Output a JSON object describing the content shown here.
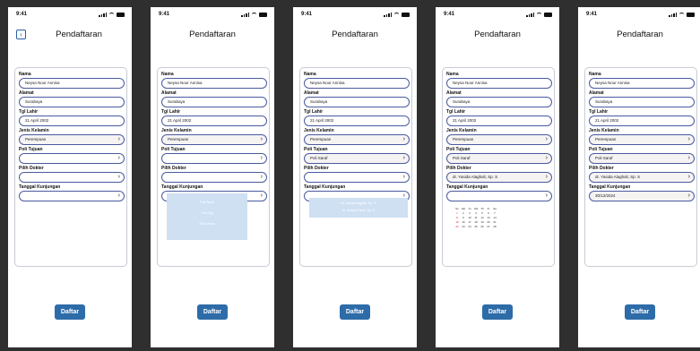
{
  "status_time": "9:41",
  "header_title": "Pendaftaran",
  "labels": {
    "nama": "Nama",
    "alamat": "Alamat",
    "tgl_lahir": "Tgl Lahir",
    "jenis_kelamin": "Jenis Kelamin",
    "poli_tujuan": "Poli Tujuan",
    "pilih_dokter": "Pilih Dokter",
    "tanggal_kunjungan": "Tanggal Kunjungan"
  },
  "values": {
    "nama": "Neysa Noor Annisa",
    "alamat": "Surabaya",
    "tgl_lahir": "21 April 2002",
    "jenis_kelamin": "Perempuan",
    "poli_tujuan": "Poli Saraf",
    "pilih_dokter": "dr. Yasida Alaghali, Sp. S",
    "tanggal_kunjungan": "30/12/2024"
  },
  "submit_label": "Daftar",
  "dropdown_poli": [
    "Poli Saraf",
    "Poli Gigi",
    "Poli Umum"
  ],
  "dropdown_dokter": [
    "dr. Yasida Alaghali, Sp. S",
    "dr. Ahmad Fauzi, Sp. S"
  ],
  "calendar": {
    "weekdays": [
      "Su",
      "Mo",
      "Tu",
      "We",
      "Th",
      "Fr",
      "Sa"
    ],
    "weeks": [
      [
        "1",
        "2",
        "3",
        "4",
        "5",
        "6",
        "7"
      ],
      [
        "8",
        "9",
        "10",
        "11",
        "12",
        "13",
        "14"
      ],
      [
        "15",
        "16",
        "17",
        "18",
        "19",
        "20",
        "21"
      ],
      [
        "22",
        "23",
        "24",
        "25",
        "26",
        "27",
        "28"
      ]
    ]
  },
  "icons": {
    "back": "chevron-left-icon",
    "dropdown": "chevron-right-icon"
  },
  "colors": {
    "primary": "#2d6ca8",
    "input_border": "#4a5aa0",
    "dropdown_bg": "#cfe0f3",
    "background": "#2f2f2f"
  }
}
